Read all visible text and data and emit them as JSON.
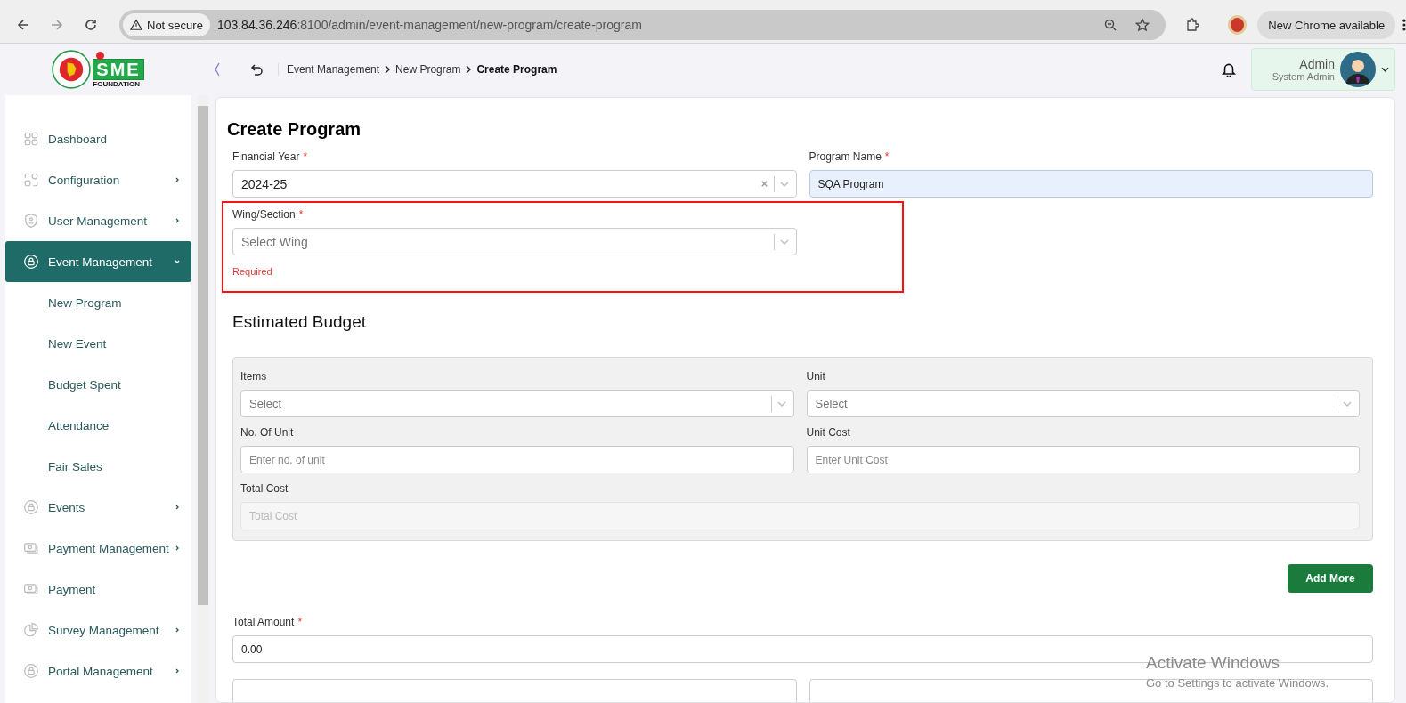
{
  "browser": {
    "security": "Not secure",
    "url_host": "103.84.36.246",
    "url_rest": ":8100/admin/event-management/new-program/create-program",
    "update_notice": "New Chrome available"
  },
  "logo": {
    "text": "SME",
    "subtext": "FOUNDATION"
  },
  "breadcrumb": [
    {
      "label": "Event Management",
      "current": false
    },
    {
      "label": "New Program",
      "current": false
    },
    {
      "label": "Create Program",
      "current": true
    }
  ],
  "user": {
    "name": "Admin",
    "role": "System Admin"
  },
  "sidebar": {
    "items": [
      {
        "label": "Dashboard",
        "expandable": false,
        "selected": false
      },
      {
        "label": "Configuration",
        "expandable": true,
        "expanded": false,
        "selected": false
      },
      {
        "label": "User Management",
        "expandable": true,
        "expanded": false,
        "selected": false
      },
      {
        "label": "Event Management",
        "expandable": true,
        "expanded": true,
        "selected": true,
        "children": [
          {
            "label": "New Program"
          },
          {
            "label": "New Event"
          },
          {
            "label": "Budget Spent"
          },
          {
            "label": "Attendance"
          },
          {
            "label": "Fair Sales"
          }
        ]
      },
      {
        "label": "Events",
        "expandable": true,
        "expanded": false,
        "selected": false
      },
      {
        "label": "Payment Management",
        "expandable": true,
        "expanded": false,
        "selected": false
      },
      {
        "label": "Payment",
        "expandable": false,
        "selected": false
      },
      {
        "label": "Survey Management",
        "expandable": true,
        "expanded": false,
        "selected": false
      },
      {
        "label": "Portal Management",
        "expandable": true,
        "expanded": false,
        "selected": false
      }
    ]
  },
  "form": {
    "title": "Create Program",
    "fields": [
      {
        "kind": "select",
        "label": "Financial Year",
        "required_mark": "*",
        "value": "2024-25",
        "clearable": true
      },
      {
        "kind": "input",
        "label": "Program Name",
        "required_mark": "*",
        "value": "SQA Program",
        "autofilled": true
      },
      {
        "kind": "select",
        "label": "Wing/Section",
        "required_mark": "*",
        "placeholder": "Select Wing",
        "error": "Required",
        "clearable": false,
        "highlighted": true
      }
    ],
    "budget": {
      "title": "Estimated Budget",
      "fields": [
        {
          "kind": "select",
          "label": "Items",
          "placeholder": "Select",
          "clearable": false
        },
        {
          "kind": "select",
          "label": "Unit",
          "placeholder": "Select",
          "clearable": false
        },
        {
          "kind": "input",
          "label": "No. Of Unit",
          "placeholder": "Enter no. of unit",
          "disabled": false
        },
        {
          "kind": "input",
          "label": "Unit Cost",
          "placeholder": "Enter Unit Cost",
          "disabled": false
        },
        {
          "kind": "input",
          "label": "Total Cost",
          "placeholder": "Total Cost",
          "disabled": true,
          "wide": true
        }
      ],
      "add_button": "Add More"
    },
    "total": {
      "label": "Total Amount",
      "required_mark": "*",
      "value": "0.00"
    }
  },
  "os_notice": {
    "title": "Activate Windows",
    "text": "Go to Settings to activate Windows."
  }
}
